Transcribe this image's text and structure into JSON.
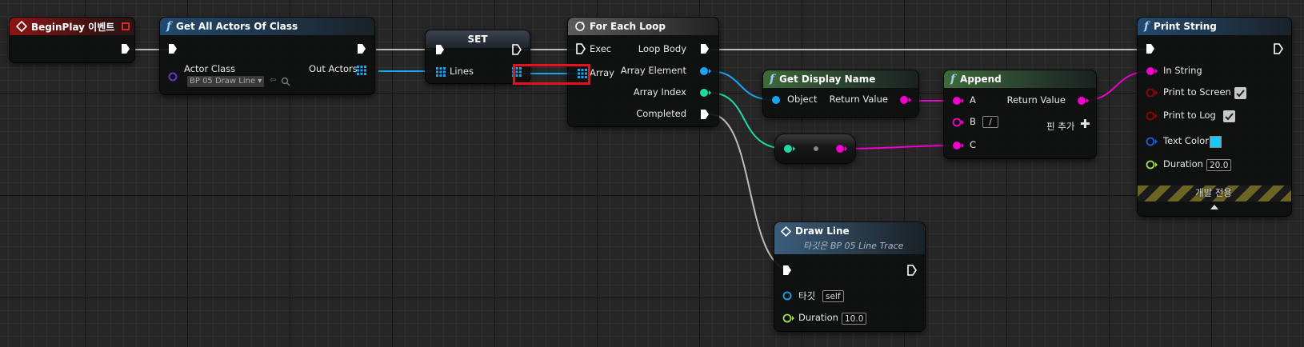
{
  "nodes": {
    "begin_play": {
      "title": "BeginPlay 이벤트"
    },
    "get_all_actors": {
      "title": "Get All Actors Of Class",
      "actor_class_label": "Actor Class",
      "actor_class_value": "BP 05 Draw Line",
      "out_actors_label": "Out Actors"
    },
    "set": {
      "title": "SET",
      "lines_label": "Lines"
    },
    "for_each": {
      "title": "For Each Loop",
      "exec_label": "Exec",
      "loop_body_label": "Loop Body",
      "array_label": "Array",
      "array_element_label": "Array Element",
      "array_index_label": "Array Index",
      "completed_label": "Completed"
    },
    "get_display_name": {
      "title": "Get Display Name",
      "object_label": "Object",
      "return_label": "Return Value"
    },
    "append": {
      "title": "Append",
      "a_label": "A",
      "b_label": "B",
      "b_value": "/",
      "c_label": "C",
      "return_label": "Return Value",
      "add_pin_label": "핀 추가"
    },
    "print_string": {
      "title": "Print String",
      "in_string_label": "In String",
      "print_screen_label": "Print to Screen",
      "print_log_label": "Print to Log",
      "text_color_label": "Text Color",
      "duration_label": "Duration",
      "duration_value": "20.0",
      "dev_only_label": "개발 전용"
    },
    "draw_line": {
      "title": "Draw Line",
      "subtitle": "타깃은 BP 05 Line Trace",
      "target_label": "타깃",
      "target_value": "self",
      "duration_label": "Duration",
      "duration_value": "10.0"
    }
  },
  "colors": {
    "exec": "#ffffff",
    "object": "#1aa4f0",
    "integer": "#1edba6",
    "string": "#f000c8",
    "bool": "#950000",
    "float": "#a0e050",
    "highlight": "#e8111b"
  }
}
